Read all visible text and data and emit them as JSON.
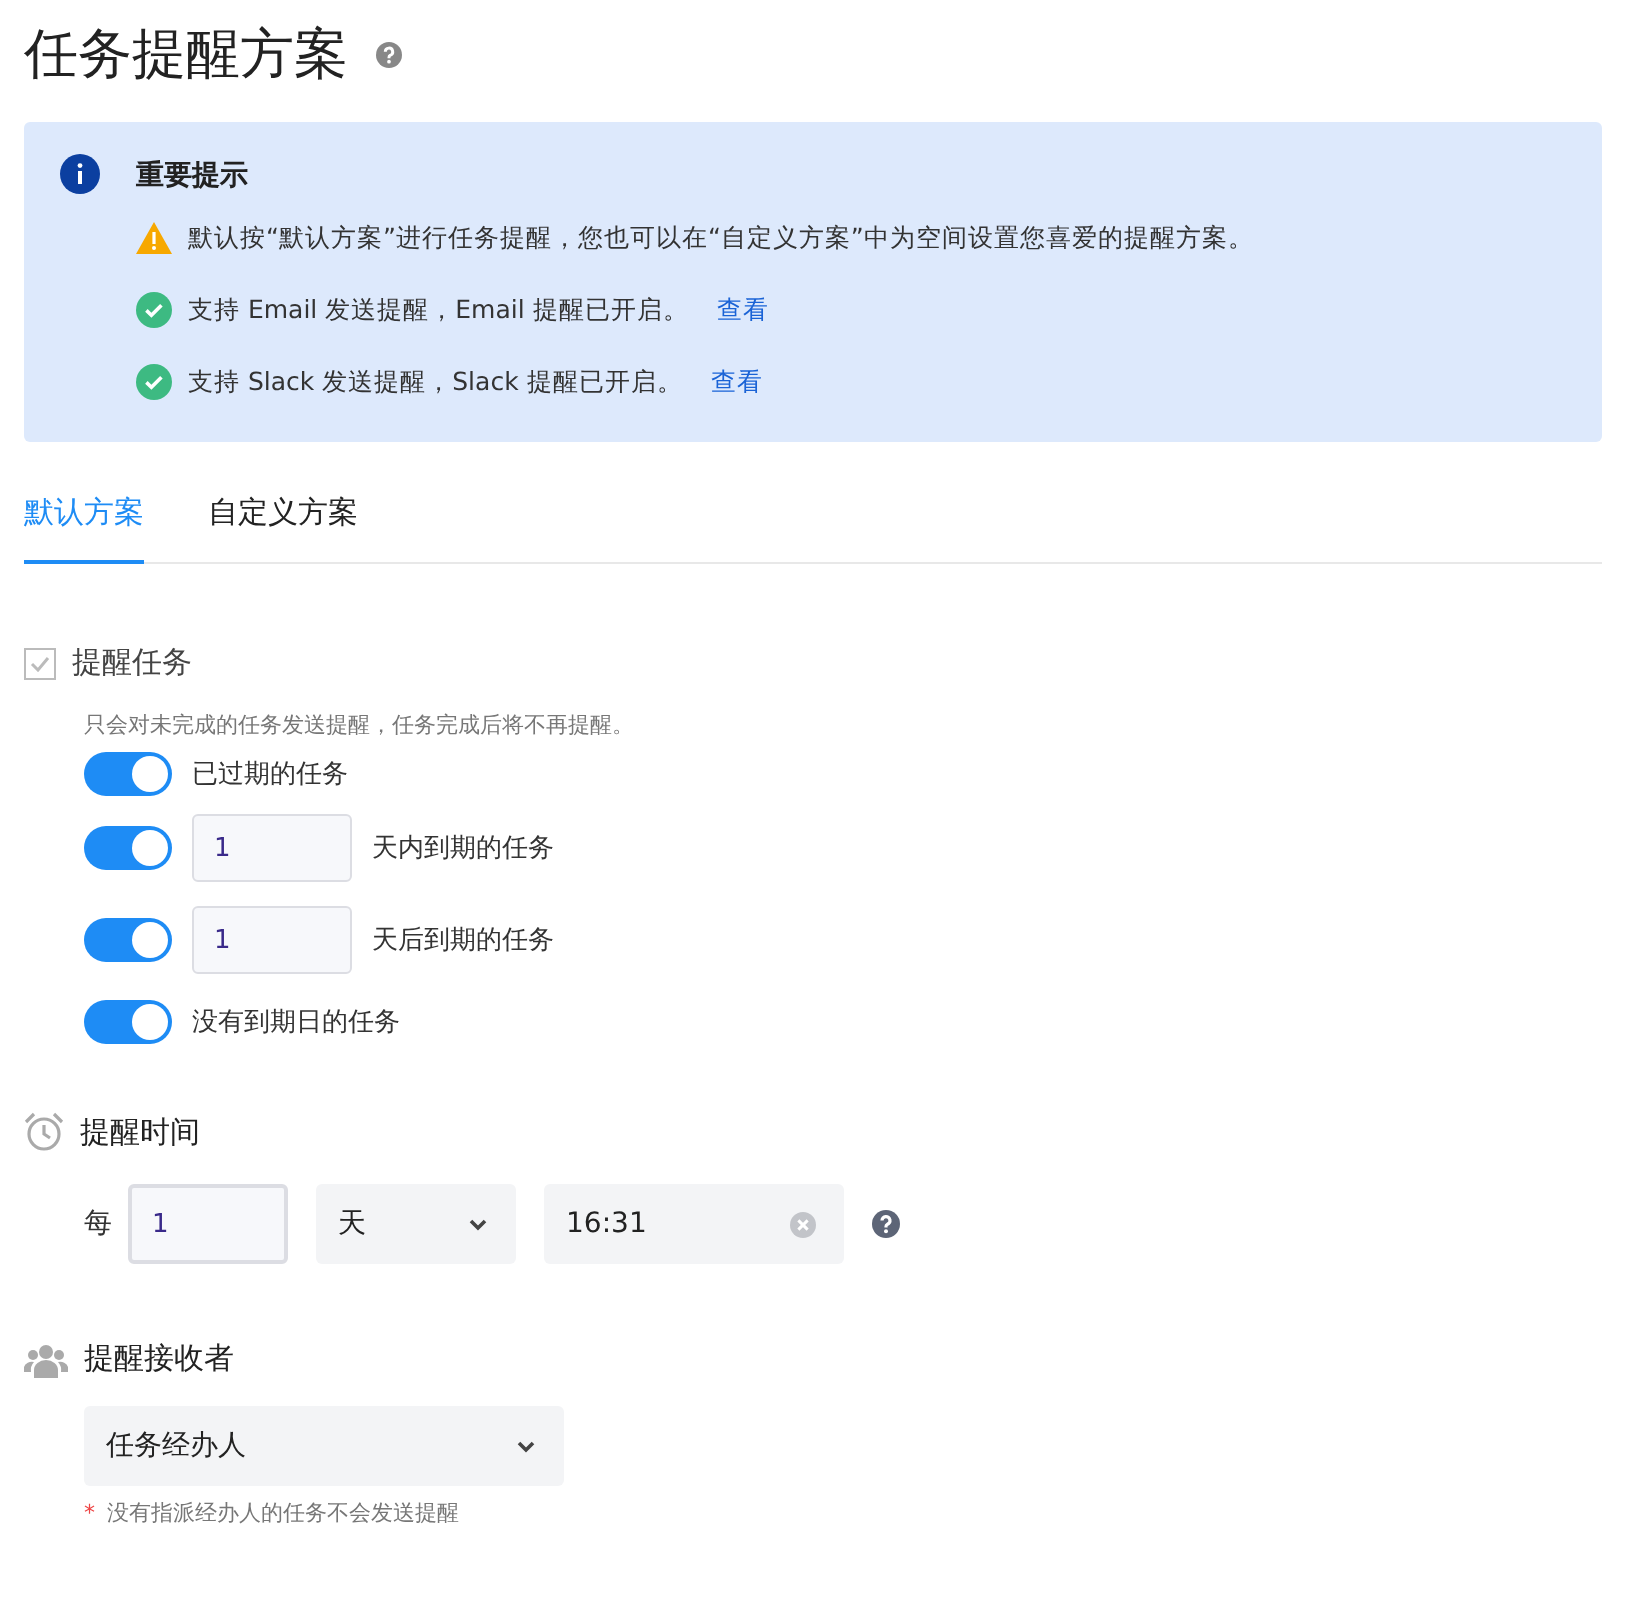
{
  "title": "任务提醒方案",
  "notice": {
    "title": "重要提示",
    "items": [
      {
        "kind": "warning",
        "text": "默认按“默认方案”进行任务提醒，您也可以在“自定义方案”中为空间设置您喜爱的提醒方案。"
      },
      {
        "kind": "success",
        "text": "支持 Email 发送提醒，Email 提醒已开启。",
        "link": "查看"
      },
      {
        "kind": "success",
        "text": "支持 Slack 发送提醒，Slack 提醒已开启。",
        "link": "查看"
      }
    ]
  },
  "tabs": [
    {
      "label": "默认方案",
      "selected": true
    },
    {
      "label": "自定义方案",
      "selected": false
    }
  ],
  "remind_tasks": {
    "label": "提醒任务",
    "checked": true,
    "disabled": true,
    "hint": "只会对未完成的任务发送提醒，任务完成后将不再提醒。",
    "rules": [
      {
        "kind": "toggle",
        "on": true,
        "text": "已过期的任务"
      },
      {
        "kind": "days",
        "on": true,
        "days": "1",
        "suffix": "天内到期的任务"
      },
      {
        "kind": "days",
        "on": true,
        "days": "1",
        "suffix": "天后到期的任务"
      },
      {
        "kind": "toggle",
        "on": true,
        "text": "没有到期日的任务"
      }
    ]
  },
  "remind_time": {
    "label": "提醒时间",
    "prefix": "每",
    "interval": "1",
    "unit": "天",
    "time": "16:31"
  },
  "recipients": {
    "label": "提醒接收者",
    "value": "任务经办人",
    "note_mark": "*",
    "note": "没有指派经办人的任务不会发送提醒"
  }
}
